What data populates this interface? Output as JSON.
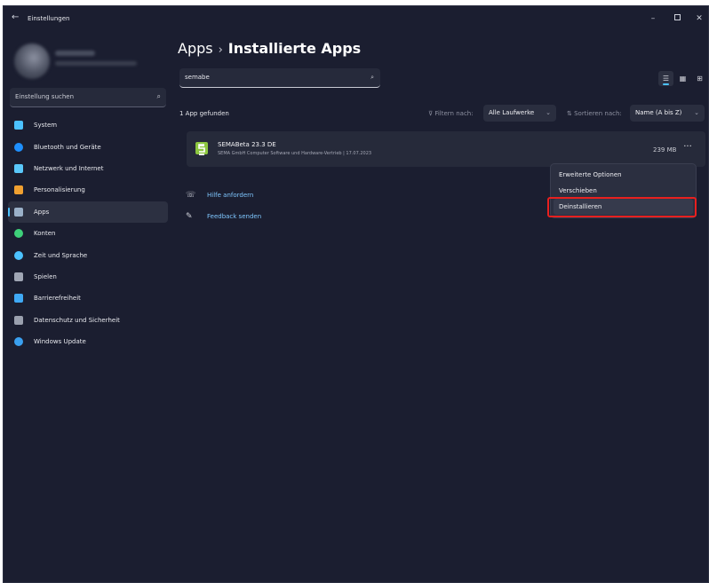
{
  "window": {
    "back_icon": "←",
    "title": "Einstellungen",
    "minimize_icon": "–",
    "close_icon": "✕"
  },
  "sidebar": {
    "search_placeholder": "Einstellung suchen",
    "search_icon": "⌕",
    "items": [
      {
        "label": "System",
        "icon": "monitor-icon",
        "color": "#4cc2ff"
      },
      {
        "label": "Bluetooth und Geräte",
        "icon": "bluetooth-icon",
        "color": "#1e90ff"
      },
      {
        "label": "Netzwerk und Internet",
        "icon": "wifi-icon",
        "color": "#5ac8fa"
      },
      {
        "label": "Personalisierung",
        "icon": "brush-icon",
        "color": "#f0a030"
      },
      {
        "label": "Apps",
        "icon": "apps-icon",
        "color": "#9ab0c8",
        "active": true
      },
      {
        "label": "Konten",
        "icon": "person-icon",
        "color": "#3ed07a"
      },
      {
        "label": "Zeit und Sprache",
        "icon": "globe-clock-icon",
        "color": "#4cc2ff"
      },
      {
        "label": "Spielen",
        "icon": "gamepad-icon",
        "color": "#a0a6b4"
      },
      {
        "label": "Barrierefreiheit",
        "icon": "accessibility-icon",
        "color": "#3fa9f5"
      },
      {
        "label": "Datenschutz und Sicherheit",
        "icon": "shield-icon",
        "color": "#9aa0ae"
      },
      {
        "label": "Windows Update",
        "icon": "update-icon",
        "color": "#3aa0f0"
      }
    ]
  },
  "main": {
    "breadcrumb_parent": "Apps",
    "breadcrumb_sep": "›",
    "breadcrumb_current": "Installierte Apps",
    "search_value": "semabe",
    "search_icon": "⌕",
    "found_text": "1 App gefunden",
    "filter_label": "⊽ Filtern nach:",
    "filter_value": "Alle Laufwerke",
    "sort_label": "⇅ Sortieren nach:",
    "sort_value": "Name (A bis Z)",
    "chevron": "⌄",
    "view_list_icon": "☰",
    "view_grid_icon": "▦",
    "view_tile_icon": "⊞",
    "app": {
      "name": "SEMABeta 23.3 DE",
      "meta": "SEMA GmbH Computer Software und Hardware-Vertrieb  |  17.07.2023",
      "size": "239 MB",
      "more": "···"
    },
    "links": [
      {
        "label": "Hilfe anfordern",
        "icon": "help-icon",
        "glyph": "☏"
      },
      {
        "label": "Feedback senden",
        "icon": "feedback-icon",
        "glyph": "✎"
      }
    ],
    "context_menu": [
      "Erweiterte Optionen",
      "Verschieben",
      "Deinstallieren"
    ]
  },
  "accent_color": "#4cc2ff",
  "highlight_color": "#e8201f"
}
